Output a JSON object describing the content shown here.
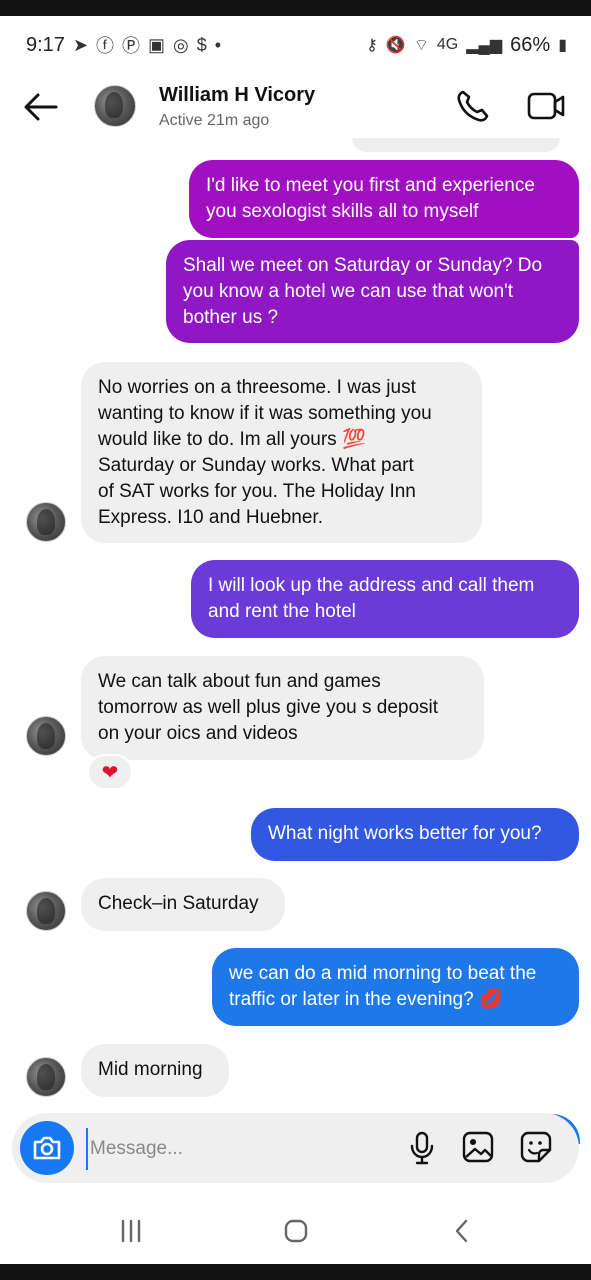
{
  "status_bar": {
    "time": "9:17",
    "battery": "66%",
    "network": "4G",
    "left_icons": [
      "send-icon",
      "facebook-icon",
      "pinterest-icon",
      "gallery-icon",
      "instagram-icon",
      "dollar-icon",
      "dot-icon"
    ],
    "right_icons": [
      "key-icon",
      "mute-icon",
      "wifi-icon",
      "signal-icon",
      "battery-icon"
    ]
  },
  "header": {
    "name": "William H Vicory",
    "status": "Active 21m ago"
  },
  "messages": [
    {
      "side": "out",
      "text": "I'd like to meet you first and experience\nyou sexologist skills all to myself"
    },
    {
      "side": "out",
      "text": "Shall we meet on Saturday or Sunday? Do\nyou know a hotel we can use that won't\nbother us ?"
    },
    {
      "side": "in",
      "text": "No worries on a threesome.  I was just\nwanting to know if it was something you\nwould like to do.  Im all yours 💯\nSaturday or Sunday works. What part\nof SAT works for you. The Holiday Inn\nExpress.  I10 and Huebner."
    },
    {
      "side": "out",
      "text": "I will look up the address and call them\nand rent the hotel"
    },
    {
      "side": "in",
      "text": "We can talk about fun and games\ntomorrow as well plus give you s deposit\non your oics and videos",
      "reaction": "❤"
    },
    {
      "side": "out",
      "text": "What night works better for you?"
    },
    {
      "side": "in",
      "text": "Check–in Saturday"
    },
    {
      "side": "out",
      "text": "we can do a mid morning to beat the\ntraffic or later in the evening? 💋"
    },
    {
      "side": "in",
      "text": "Mid morning"
    }
  ],
  "composer": {
    "placeholder": "Message...",
    "value": ""
  },
  "colors": {
    "accent": "#1877f2",
    "incoming_bubble": "#efefef",
    "outgoing_gradient": [
      "#a010c0",
      "#9018c4",
      "#6a3bd7",
      "#3258e2",
      "#1f78e8"
    ]
  }
}
